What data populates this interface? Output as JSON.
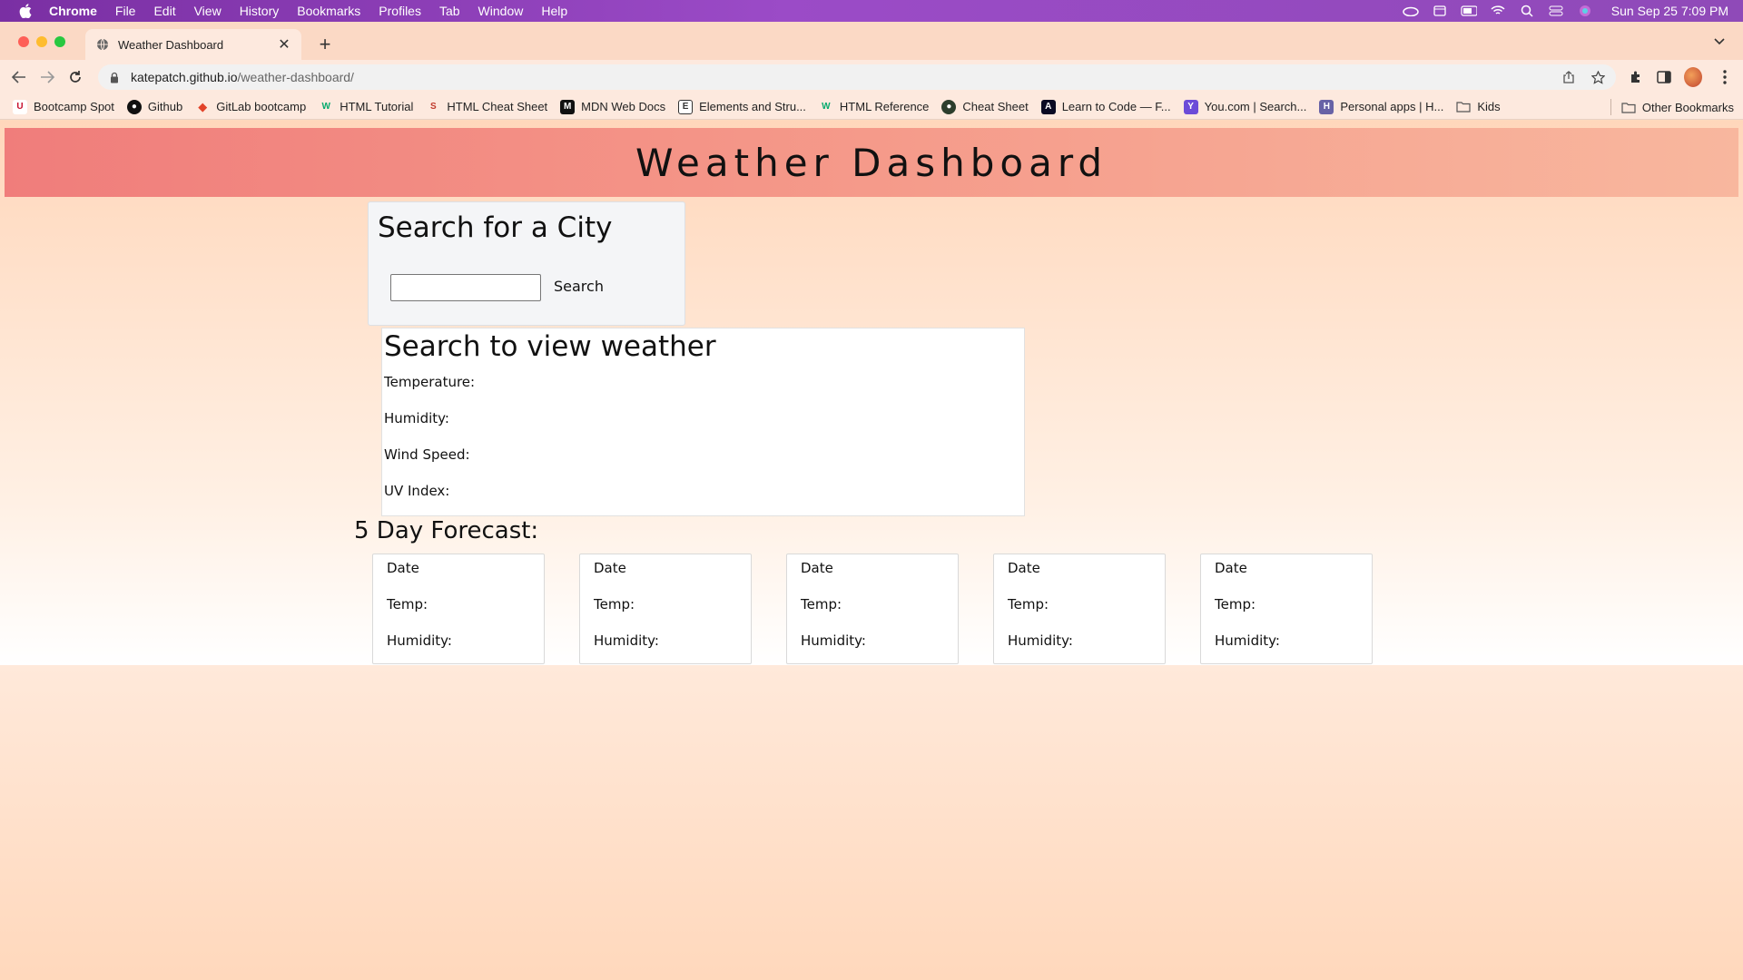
{
  "menubar": {
    "app_name": "Chrome",
    "items": [
      "File",
      "Edit",
      "View",
      "History",
      "Bookmarks",
      "Profiles",
      "Tab",
      "Window",
      "Help"
    ],
    "clock": "Sun Sep 25  7:09 PM"
  },
  "tab": {
    "title": "Weather Dashboard"
  },
  "address_bar": {
    "host": "katepatch.github.io",
    "path": "/weather-dashboard/"
  },
  "bookmarks": [
    {
      "label": "Bootcamp Spot",
      "icon": "bootcamp-icon",
      "color": "#c8102e",
      "glyph": "U"
    },
    {
      "label": "Github",
      "icon": "github-icon",
      "color": "#111111",
      "glyph": "●"
    },
    {
      "label": "GitLab bootcamp",
      "icon": "gitlab-icon",
      "color": "#e24329",
      "glyph": "◆"
    },
    {
      "label": "HTML Tutorial",
      "icon": "w3schools-icon",
      "color": "#04aa6d",
      "glyph": "W"
    },
    {
      "label": "HTML Cheat Sheet",
      "icon": "cheatsheet-icon",
      "color": "#c0392b",
      "glyph": "S"
    },
    {
      "label": "MDN Web Docs",
      "icon": "mdn-icon",
      "color": "#111111",
      "glyph": "M"
    },
    {
      "label": "Elements and Stru...",
      "icon": "document-icon",
      "color": "#333333",
      "glyph": "E"
    },
    {
      "label": "HTML Reference",
      "icon": "w3schools-icon",
      "color": "#04aa6d",
      "glyph": "W"
    },
    {
      "label": "Cheat Sheet",
      "icon": "cheatsheet-icon",
      "color": "#2c3e2d",
      "glyph": "●"
    },
    {
      "label": "Learn to Code — F...",
      "icon": "freecodecamp-icon",
      "color": "#0a0a23",
      "glyph": "A"
    },
    {
      "label": "You.com | Search...",
      "icon": "youcom-icon",
      "color": "#6c4bd8",
      "glyph": "Y"
    },
    {
      "label": "Personal apps | H...",
      "icon": "heroku-icon",
      "color": "#6762a6",
      "glyph": "H"
    },
    {
      "label": "Kids",
      "icon": "folder-icon",
      "color": "#555555",
      "glyph": "▭"
    }
  ],
  "other_bookmarks": "Other Bookmarks",
  "page": {
    "header_title": "Weather Dashboard",
    "search_heading": "Search for a City",
    "search_input_value": "",
    "search_button": "Search",
    "current_heading": "Search to view weather",
    "current_fields": {
      "temperature": "Temperature:",
      "humidity": "Humidity:",
      "wind": "Wind Speed:",
      "uv": "UV Index:"
    },
    "forecast_title": "5 Day Forecast:",
    "forecast_cards": [
      {
        "date": "Date",
        "temp": "Temp:",
        "humidity": "Humidity:"
      },
      {
        "date": "Date",
        "temp": "Temp:",
        "humidity": "Humidity:"
      },
      {
        "date": "Date",
        "temp": "Temp:",
        "humidity": "Humidity:"
      },
      {
        "date": "Date",
        "temp": "Temp:",
        "humidity": "Humidity:"
      },
      {
        "date": "Date",
        "temp": "Temp:",
        "humidity": "Humidity:"
      }
    ]
  }
}
